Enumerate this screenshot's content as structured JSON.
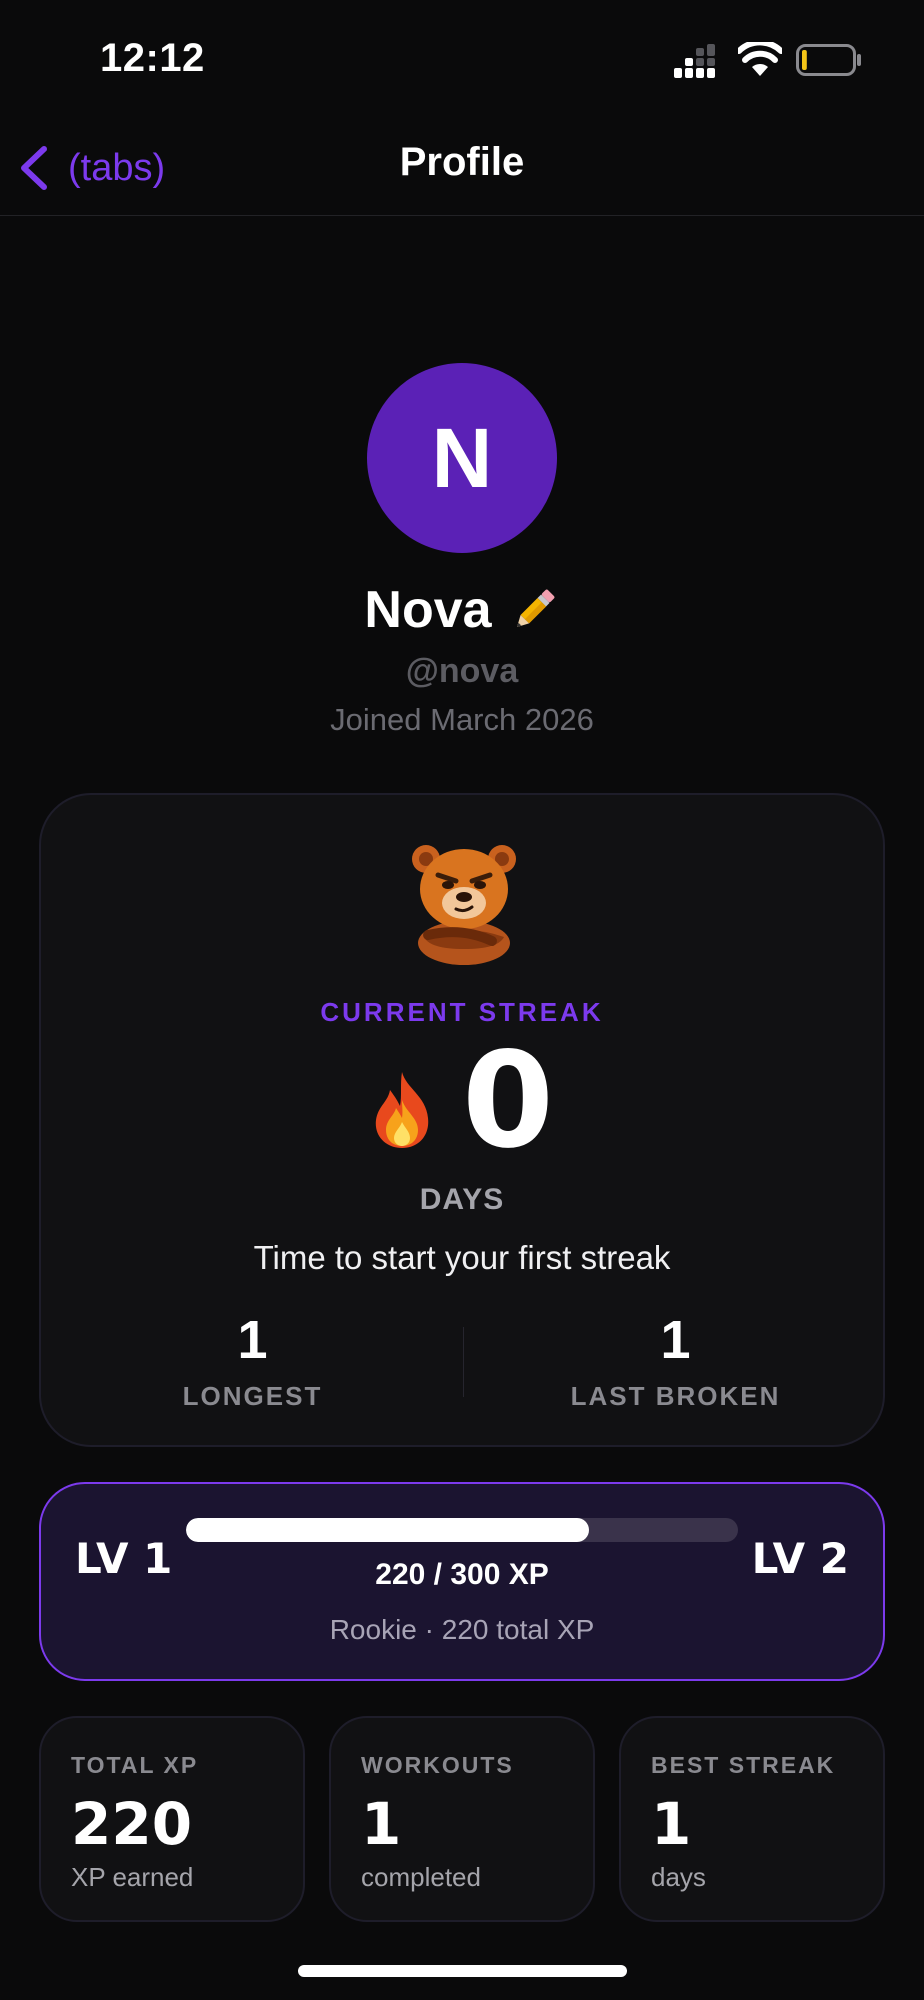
{
  "status_bar": {
    "time": "12:12",
    "battery_level": 0.1
  },
  "nav": {
    "back_label": "(tabs)",
    "title": "Profile"
  },
  "profile": {
    "avatar_initial": "N",
    "name": "Nova",
    "handle": "@nova",
    "joined": "Joined March 2026",
    "avatar_color": "#5b21b6"
  },
  "streak": {
    "label": "CURRENT STREAK",
    "value": "0",
    "unit": "DAYS",
    "message": "Time to start your first streak",
    "longest_value": "1",
    "longest_label": "LONGEST",
    "last_broken_value": "1",
    "last_broken_label": "LAST BROKEN"
  },
  "level": {
    "current": "LV 1",
    "next": "LV 2",
    "xp_text": "220 / 300 XP",
    "progress": 0.73,
    "subtitle": "Rookie · 220 total XP"
  },
  "tiles": [
    {
      "label": "TOTAL XP",
      "value": "220",
      "sub": "XP earned"
    },
    {
      "label": "WORKOUTS",
      "value": "1",
      "sub": "completed"
    },
    {
      "label": "BEST STREAK",
      "value": "1",
      "sub": "days"
    }
  ],
  "colors": {
    "accent": "#7c3aed",
    "background": "#0a0a0b",
    "card": "#111113",
    "level_card": "#1b1430"
  }
}
